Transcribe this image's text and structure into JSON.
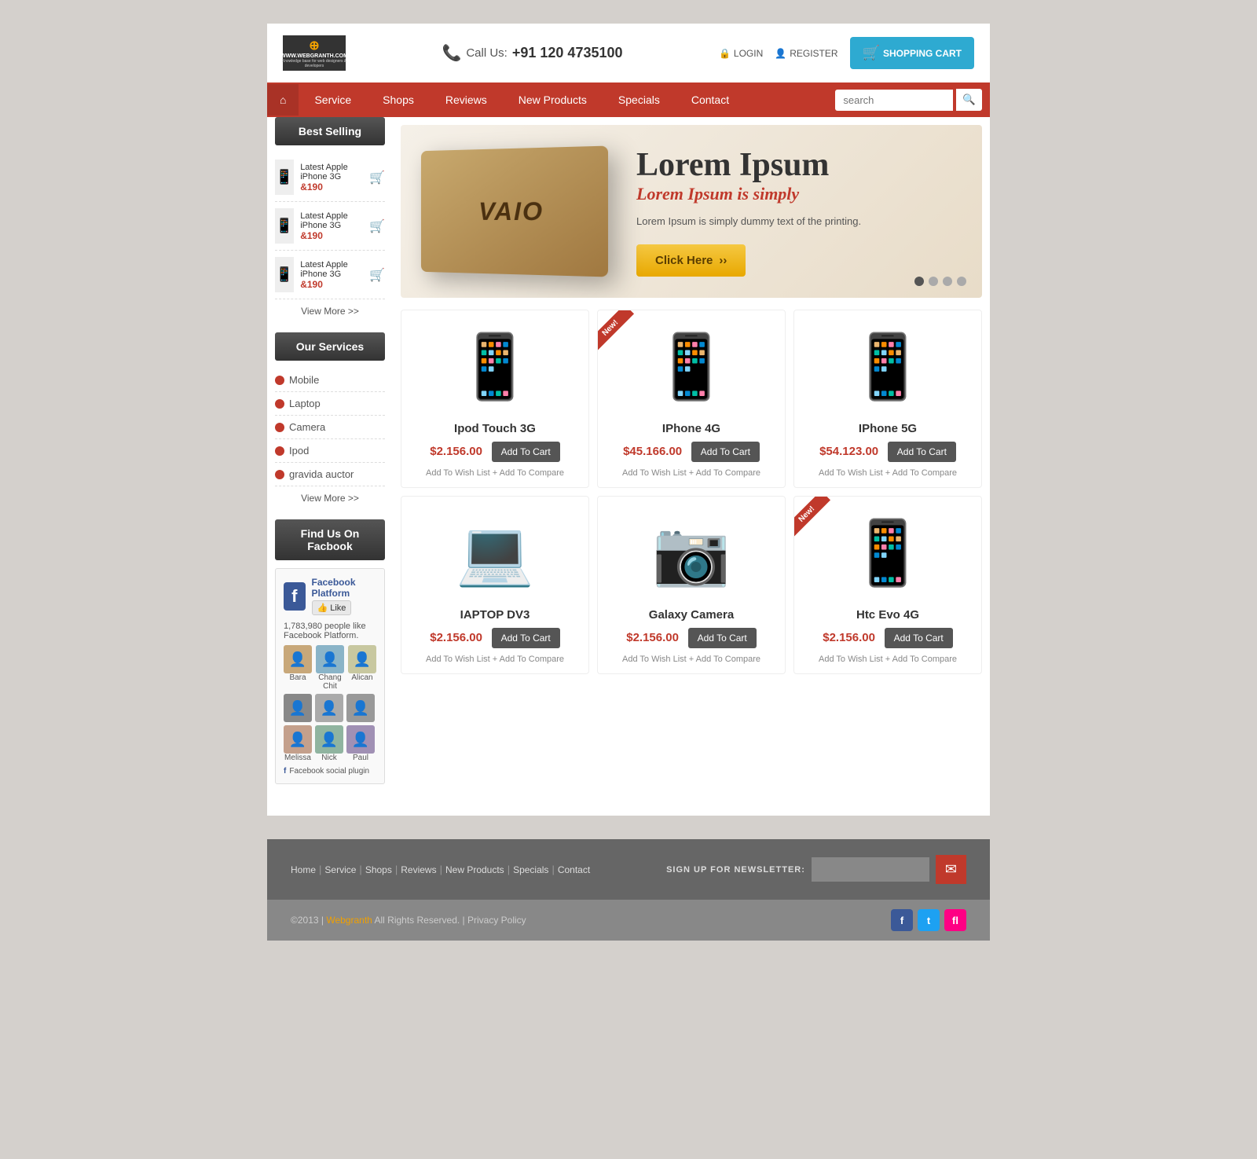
{
  "site": {
    "logo_text": "WWW.WEBGRANTH.COM",
    "logo_sub": "Knowledge base for web designers & developers",
    "phone_label": "Call Us:",
    "phone_number": "+91 120 4735100",
    "login_label": "LOGIN",
    "register_label": "REGISTER",
    "cart_label": "SHOPPING CART"
  },
  "nav": {
    "home_icon": "⌂",
    "items": [
      {
        "label": "Service",
        "url": "#"
      },
      {
        "label": "Shops",
        "url": "#"
      },
      {
        "label": "Reviews",
        "url": "#"
      },
      {
        "label": "New Products",
        "url": "#"
      },
      {
        "label": "Specials",
        "url": "#"
      },
      {
        "label": "Contact",
        "url": "#"
      }
    ],
    "search_placeholder": "search"
  },
  "sidebar": {
    "best_selling_title": "Best Selling",
    "items": [
      {
        "name": "Latest Apple iPhone 3G",
        "price": "&190"
      },
      {
        "name": "Latest Apple iPhone 3G",
        "price": "&190"
      },
      {
        "name": "Latest Apple iPhone 3G",
        "price": "&190"
      }
    ],
    "view_more": "View More >>",
    "services_title": "Our Services",
    "services": [
      {
        "label": "Mobile"
      },
      {
        "label": "Laptop"
      },
      {
        "label": "Camera"
      },
      {
        "label": "Ipod"
      },
      {
        "label": "gravida auctor"
      }
    ],
    "services_view_more": "View More >>",
    "facebook_title": "Find Us On Facbook",
    "fb_page_name": "Facebook Platform",
    "fb_like": "Like",
    "fb_count": "1,783,980 people like Facebook Platform.",
    "fb_avatars": [
      {
        "name": "Bara",
        "emoji": "👤"
      },
      {
        "name": "Chang Chit",
        "emoji": "👤"
      },
      {
        "name": "Alican",
        "emoji": "👤"
      },
      {
        "name": "",
        "emoji": "👤"
      },
      {
        "name": "",
        "emoji": "👤"
      },
      {
        "name": "",
        "emoji": "👤"
      },
      {
        "name": "Melissa",
        "emoji": "👤"
      },
      {
        "name": "Nick",
        "emoji": "👤"
      },
      {
        "name": "Paul",
        "emoji": "👤"
      }
    ],
    "fb_plugin": "Facebook social plugin"
  },
  "banner": {
    "heading": "Lorem Ipsum",
    "subheading": "Lorem Ipsum is simply",
    "body": "Lorem Ipsum is simply dummy text of the printing.",
    "cta": "Click Here",
    "laptop_text": "VAIO",
    "dots": 4
  },
  "products": [
    {
      "id": 1,
      "name": "Ipod Touch 3G",
      "price": "$2.156.00",
      "add_to_cart": "Add To Cart",
      "wish_list": "Add To Wish List",
      "compare": "+ Add To Compare",
      "is_new": false,
      "emoji": "📱"
    },
    {
      "id": 2,
      "name": "IPhone 4G",
      "price": "$45.166.00",
      "add_to_cart": "Add To Cart",
      "wish_list": "Add To Wish List",
      "compare": "+ Add To Compare",
      "is_new": true,
      "emoji": "📱"
    },
    {
      "id": 3,
      "name": "IPhone 5G",
      "price": "$54.123.00",
      "add_to_cart": "Add To Cart",
      "wish_list": "Add To Wish List",
      "compare": "+ Add To Compare",
      "is_new": false,
      "emoji": "📱"
    },
    {
      "id": 4,
      "name": "IAPTOP DV3",
      "price": "$2.156.00",
      "add_to_cart": "Add To Cart",
      "wish_list": "Add To Wish List",
      "compare": "+ Add To Compare",
      "is_new": false,
      "emoji": "💻"
    },
    {
      "id": 5,
      "name": "Galaxy Camera",
      "price": "$2.156.00",
      "add_to_cart": "Add To Cart",
      "wish_list": "Add To Wish List",
      "compare": "+ Add To Compare",
      "is_new": false,
      "emoji": "📷"
    },
    {
      "id": 6,
      "name": "Htc Evo 4G",
      "price": "$2.156.00",
      "add_to_cart": "Add To Cart",
      "wish_list": "Add To Wish List",
      "compare": "+ Add To Compare",
      "is_new": true,
      "emoji": "📱"
    }
  ],
  "footer": {
    "links": [
      {
        "label": "Home"
      },
      {
        "label": "Service"
      },
      {
        "label": "Shops"
      },
      {
        "label": "Reviews"
      },
      {
        "label": "New Products"
      },
      {
        "label": "Specials"
      },
      {
        "label": "Contact"
      }
    ],
    "newsletter_label": "SIGN UP FOR NEWSLETTER:",
    "newsletter_placeholder": "",
    "copyright": "©2013 |",
    "brand": "Webgranth",
    "rights": "All Rights Reserved. | Privacy Policy",
    "social": [
      {
        "name": "facebook",
        "icon": "f"
      },
      {
        "name": "twitter",
        "icon": "t"
      },
      {
        "name": "flickr",
        "icon": "fl"
      }
    ]
  }
}
